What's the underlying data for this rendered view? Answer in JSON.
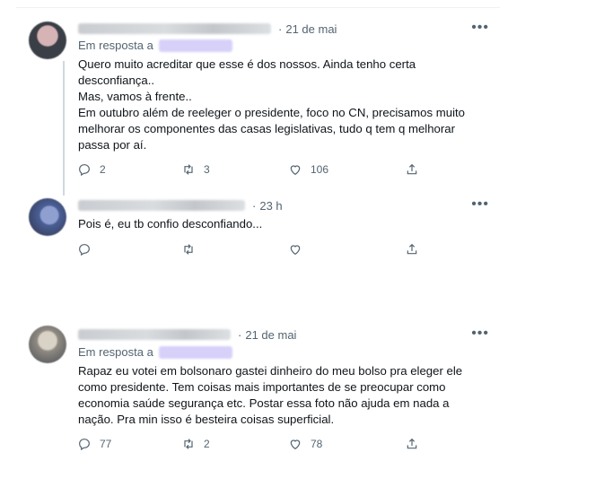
{
  "tweets": [
    {
      "time": "21 de mai",
      "more_label": "•••",
      "reply_prefix": "Em resposta a",
      "text": "Quero muito acreditar que esse é dos nossos. Ainda tenho certa\ndesconfiança..\nMas, vamos à frente..\nEm outubro além de reeleger o presidente,  foco no CN, precisamos muito\nmelhorar os componentes das casas legislativas, tudo q tem q melhorar\npassa por aí.",
      "replies": "2",
      "retweets": "3",
      "likes": "106",
      "avatar_colors": [
        "#c9a3a6",
        "#3a3f47"
      ]
    },
    {
      "time": "23 h",
      "more_label": "•••",
      "text": "Pois é, eu tb confio desconfiando...",
      "replies": "",
      "retweets": "",
      "likes": "",
      "avatar_colors": [
        "#6b7fb3",
        "#2d3446"
      ]
    },
    {
      "time": "21 de mai",
      "more_label": "•••",
      "reply_prefix": "Em resposta a",
      "text": "Rapaz eu votei em bolsonaro gastei dinheiro do meu bolso pra eleger ele\ncomo presidente. Tem coisas mais importantes de se preocupar como\neconomia saúde segurança etc. Postar essa foto não ajuda em nada a\nnação. Pra min isso é besteira coisas superficial.",
      "replies": "77",
      "retweets": "2",
      "likes": "78",
      "avatar_colors": [
        "#b7b0a3",
        "#4b4f55"
      ]
    }
  ],
  "icons": {
    "reply": "reply-icon",
    "retweet": "retweet-icon",
    "like": "like-icon",
    "share": "share-icon"
  }
}
